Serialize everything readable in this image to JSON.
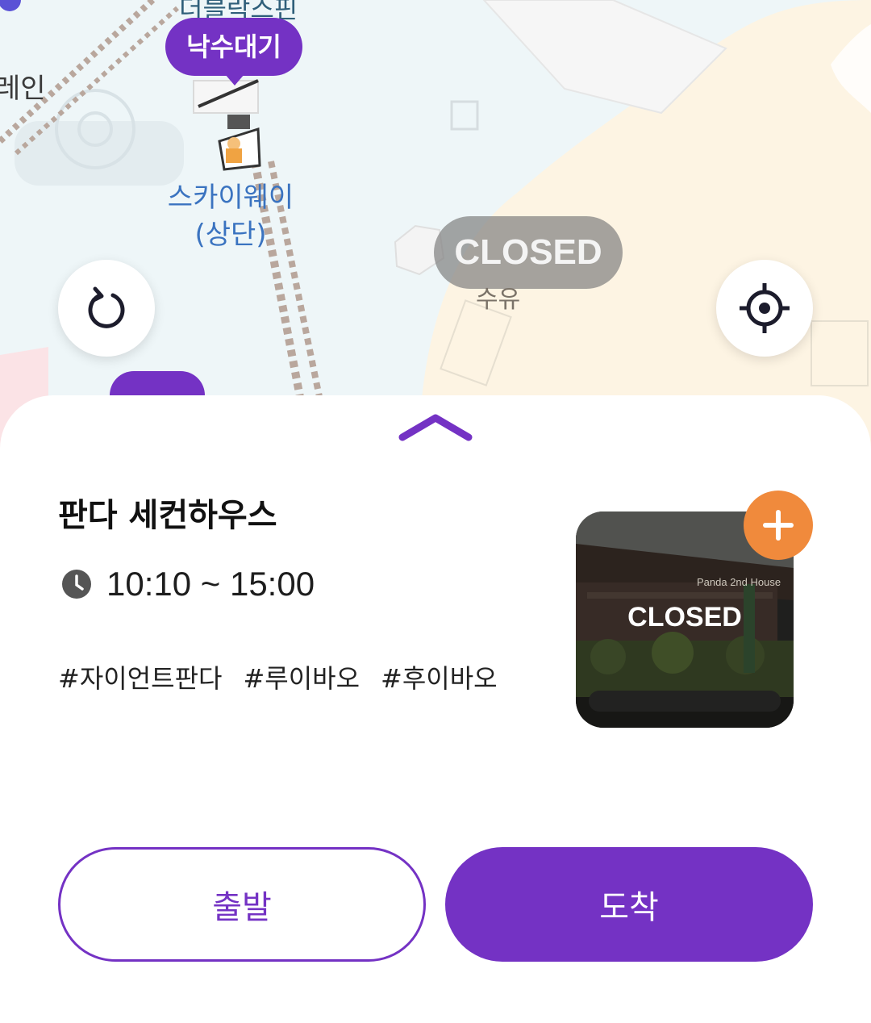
{
  "map": {
    "labels": {
      "top_partial": "더블락스핀",
      "train": "레인",
      "skyway": "스카이웨이",
      "skyway_sub": "(상단)",
      "suyu": "수유"
    },
    "wait_pin": "낙수대기",
    "closed_pin": "CLOSED",
    "icons": {
      "refresh": "refresh-icon",
      "locate": "crosshair-icon"
    }
  },
  "sheet": {
    "title": "판다 세컨하우스",
    "hours_icon": "clock-icon",
    "hours": "10:10 ~ 15:00",
    "tags": [
      "#자이언트판다",
      "#루이바오",
      "#후이바오"
    ],
    "thumbnail": {
      "status": "CLOSED",
      "sign_text": "Panda 2nd House"
    },
    "add_icon": "plus-icon"
  },
  "actions": {
    "depart": "출발",
    "arrive": "도착"
  },
  "colors": {
    "accent": "#7432c4",
    "add_button": "#f08a3c",
    "closed_pill": "#8a8a8a"
  }
}
